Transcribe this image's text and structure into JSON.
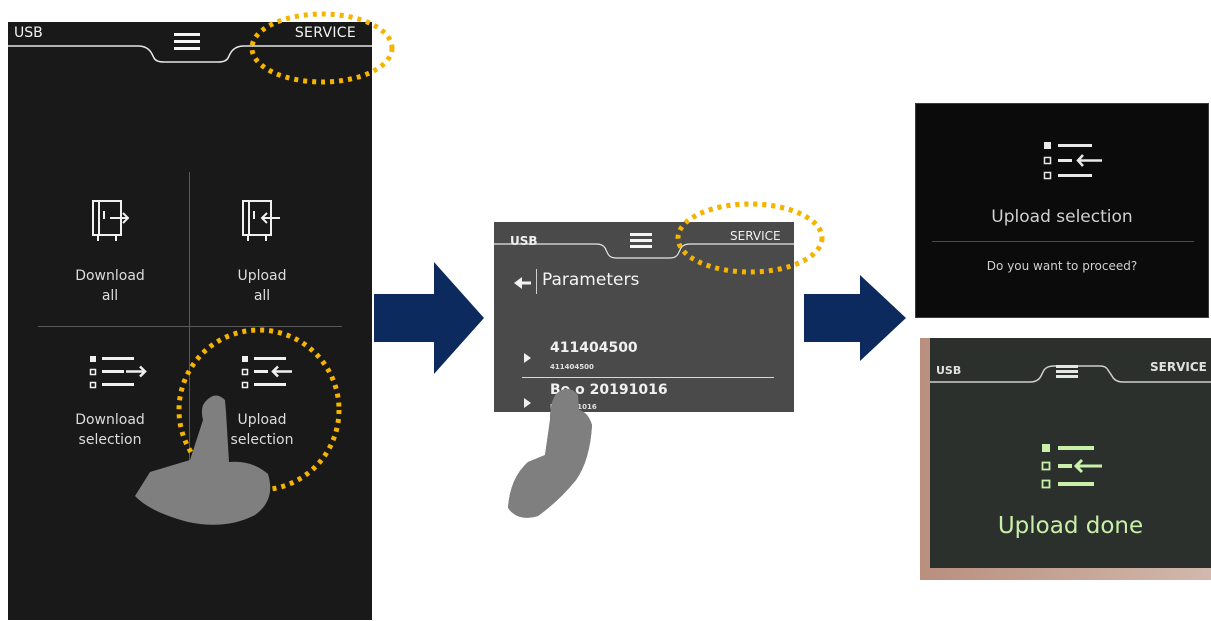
{
  "panel1": {
    "usb": "USB",
    "service": "SERVICE",
    "tiles": [
      {
        "line1": "Download",
        "line2": "all"
      },
      {
        "line1": "Upload",
        "line2": "all"
      },
      {
        "line1": "Download",
        "line2": "selection"
      },
      {
        "line1": "Upload",
        "line2": "selection"
      }
    ]
  },
  "panel2": {
    "usb": "USB",
    "service": "SERVICE",
    "title": "Parameters",
    "items": [
      {
        "name": "411404500",
        "sub": "411404500"
      },
      {
        "name": "Bo    o 20191016",
        "sub": "B       20191016"
      }
    ]
  },
  "panel3": {
    "title": "Upload selection",
    "question": "Do you want to proceed?"
  },
  "panel4": {
    "usb": "USB",
    "service": "SERVICE",
    "status": "Upload done"
  },
  "colors": {
    "highlight": "#f5b400",
    "arrow": "#0d2a5e",
    "upload_done_green": "#c8f0a8"
  }
}
